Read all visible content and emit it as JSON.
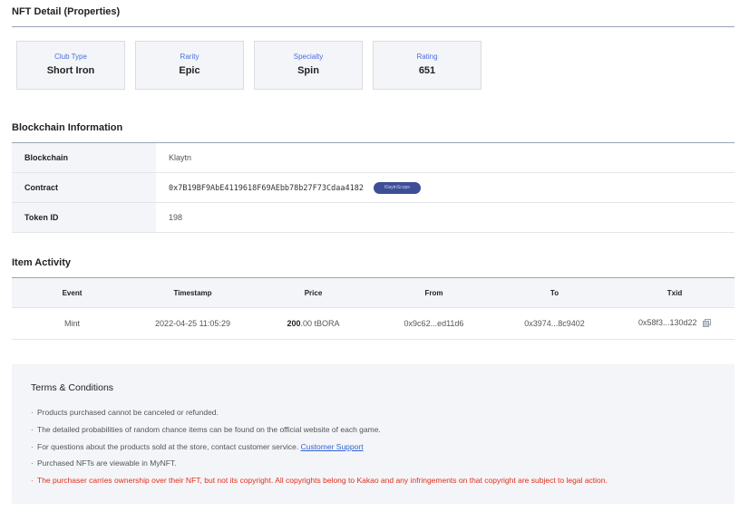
{
  "nft_detail": {
    "title": "NFT Detail (Properties)",
    "properties": [
      {
        "label": "Club Type",
        "value": "Short Iron"
      },
      {
        "label": "Rarity",
        "value": "Epic"
      },
      {
        "label": "Specialty",
        "value": "Spin"
      },
      {
        "label": "Rating",
        "value": "651"
      }
    ]
  },
  "blockchain": {
    "title": "Blockchain Information",
    "rows": [
      {
        "key": "Blockchain",
        "value": "Klaytn"
      },
      {
        "key": "Contract",
        "value": "0x7B19BF9AbE4119618F69AEbb78b27F73Cdaa4182",
        "badge": "KlaytnScope"
      },
      {
        "key": "Token ID",
        "value": "198"
      }
    ]
  },
  "activity": {
    "title": "Item Activity",
    "columns": [
      "Event",
      "Timestamp",
      "Price",
      "From",
      "To",
      "Txid"
    ],
    "rows": [
      {
        "event": "Mint",
        "timestamp": "2022-04-25 11:05:29",
        "price_amount": "200",
        "price_rest": ".00 tBORA",
        "from": "0x9c62...ed11d6",
        "to": "0x3974...8c9402",
        "txid": "0x58f3...130d22",
        "txid_icon": "copy-icon"
      }
    ]
  },
  "terms": {
    "title": "Terms & Conditions",
    "items": [
      "Products purchased cannot be canceled or refunded.",
      "The detailed probabilities of random chance items can be found on the official website of each game.",
      "For questions about the products sold at the store, contact customer service.",
      "Purchased NFTs are viewable in MyNFT.",
      "The purchaser carries ownership over their NFT, but not its copyright. All copyrights belong to Kakao and any infringements on that copyright are subject to legal action."
    ],
    "support_link": "Customer Support"
  },
  "colors": {
    "accent": "#4a6ee0",
    "warning": "#e0301e",
    "badge_bg": "#3d4e96",
    "panel_bg": "#f4f5f8"
  }
}
